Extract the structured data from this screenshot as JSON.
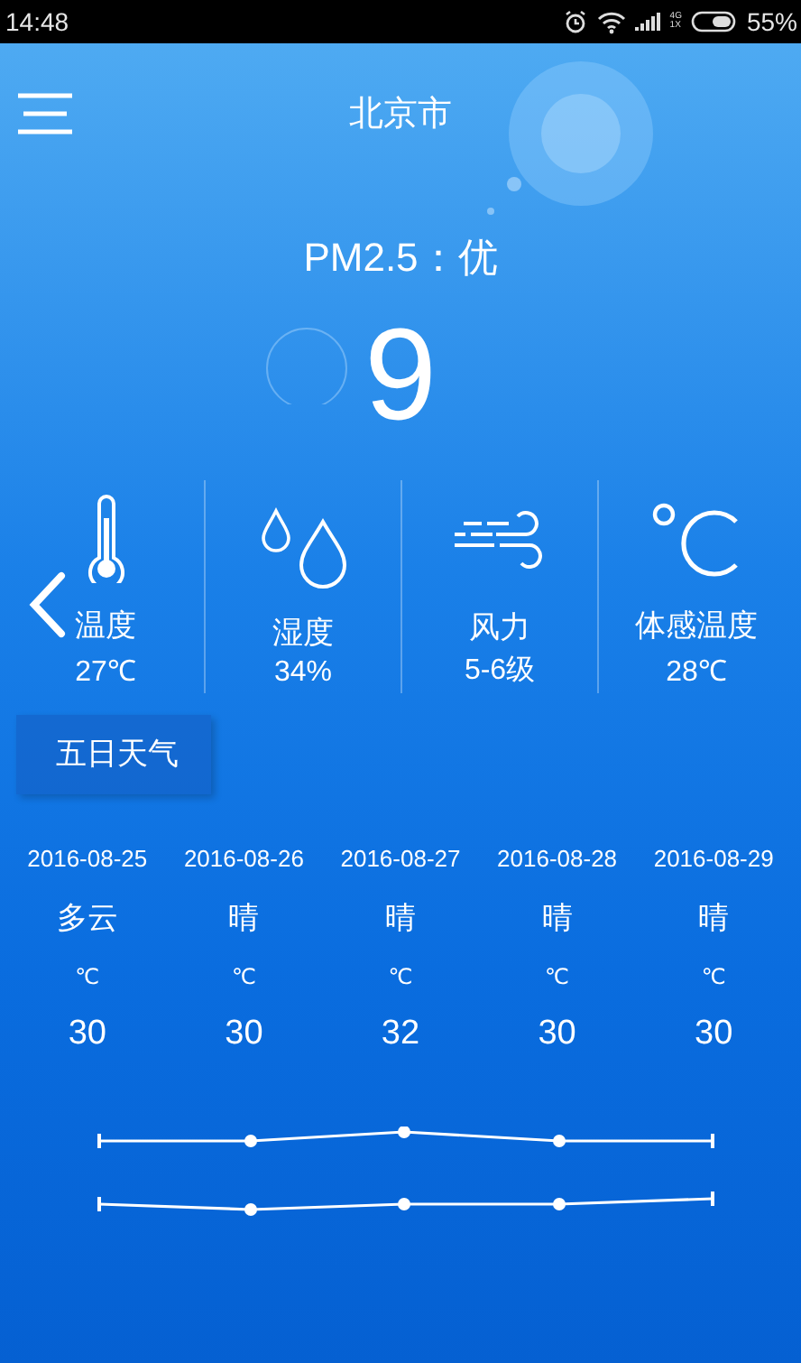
{
  "status_bar": {
    "time": "14:48",
    "network": [
      "4G",
      "1X"
    ],
    "battery": "55%"
  },
  "header": {
    "title": "北京市"
  },
  "air": {
    "label": "PM2.5：优",
    "value": "9"
  },
  "stats": [
    {
      "kind": "thermometer",
      "label": "温度",
      "value": "27℃"
    },
    {
      "kind": "drops",
      "label": "湿度",
      "value": "34%"
    },
    {
      "kind": "wind",
      "label": "风力",
      "value": "5-6级"
    },
    {
      "kind": "celsius",
      "label": "体感温度",
      "value": "28℃"
    }
  ],
  "five_day_tab": {
    "label": "五日天气"
  },
  "forecast": [
    {
      "date": "2016-08-25",
      "weather": "多云",
      "unit": "℃",
      "temp": "30"
    },
    {
      "date": "2016-08-26",
      "weather": "晴",
      "unit": "℃",
      "temp": "30"
    },
    {
      "date": "2016-08-27",
      "weather": "晴",
      "unit": "℃",
      "temp": "32"
    },
    {
      "date": "2016-08-28",
      "weather": "晴",
      "unit": "℃",
      "temp": "30"
    },
    {
      "date": "2016-08-29",
      "weather": "晴",
      "unit": "℃",
      "temp": "30"
    }
  ]
}
